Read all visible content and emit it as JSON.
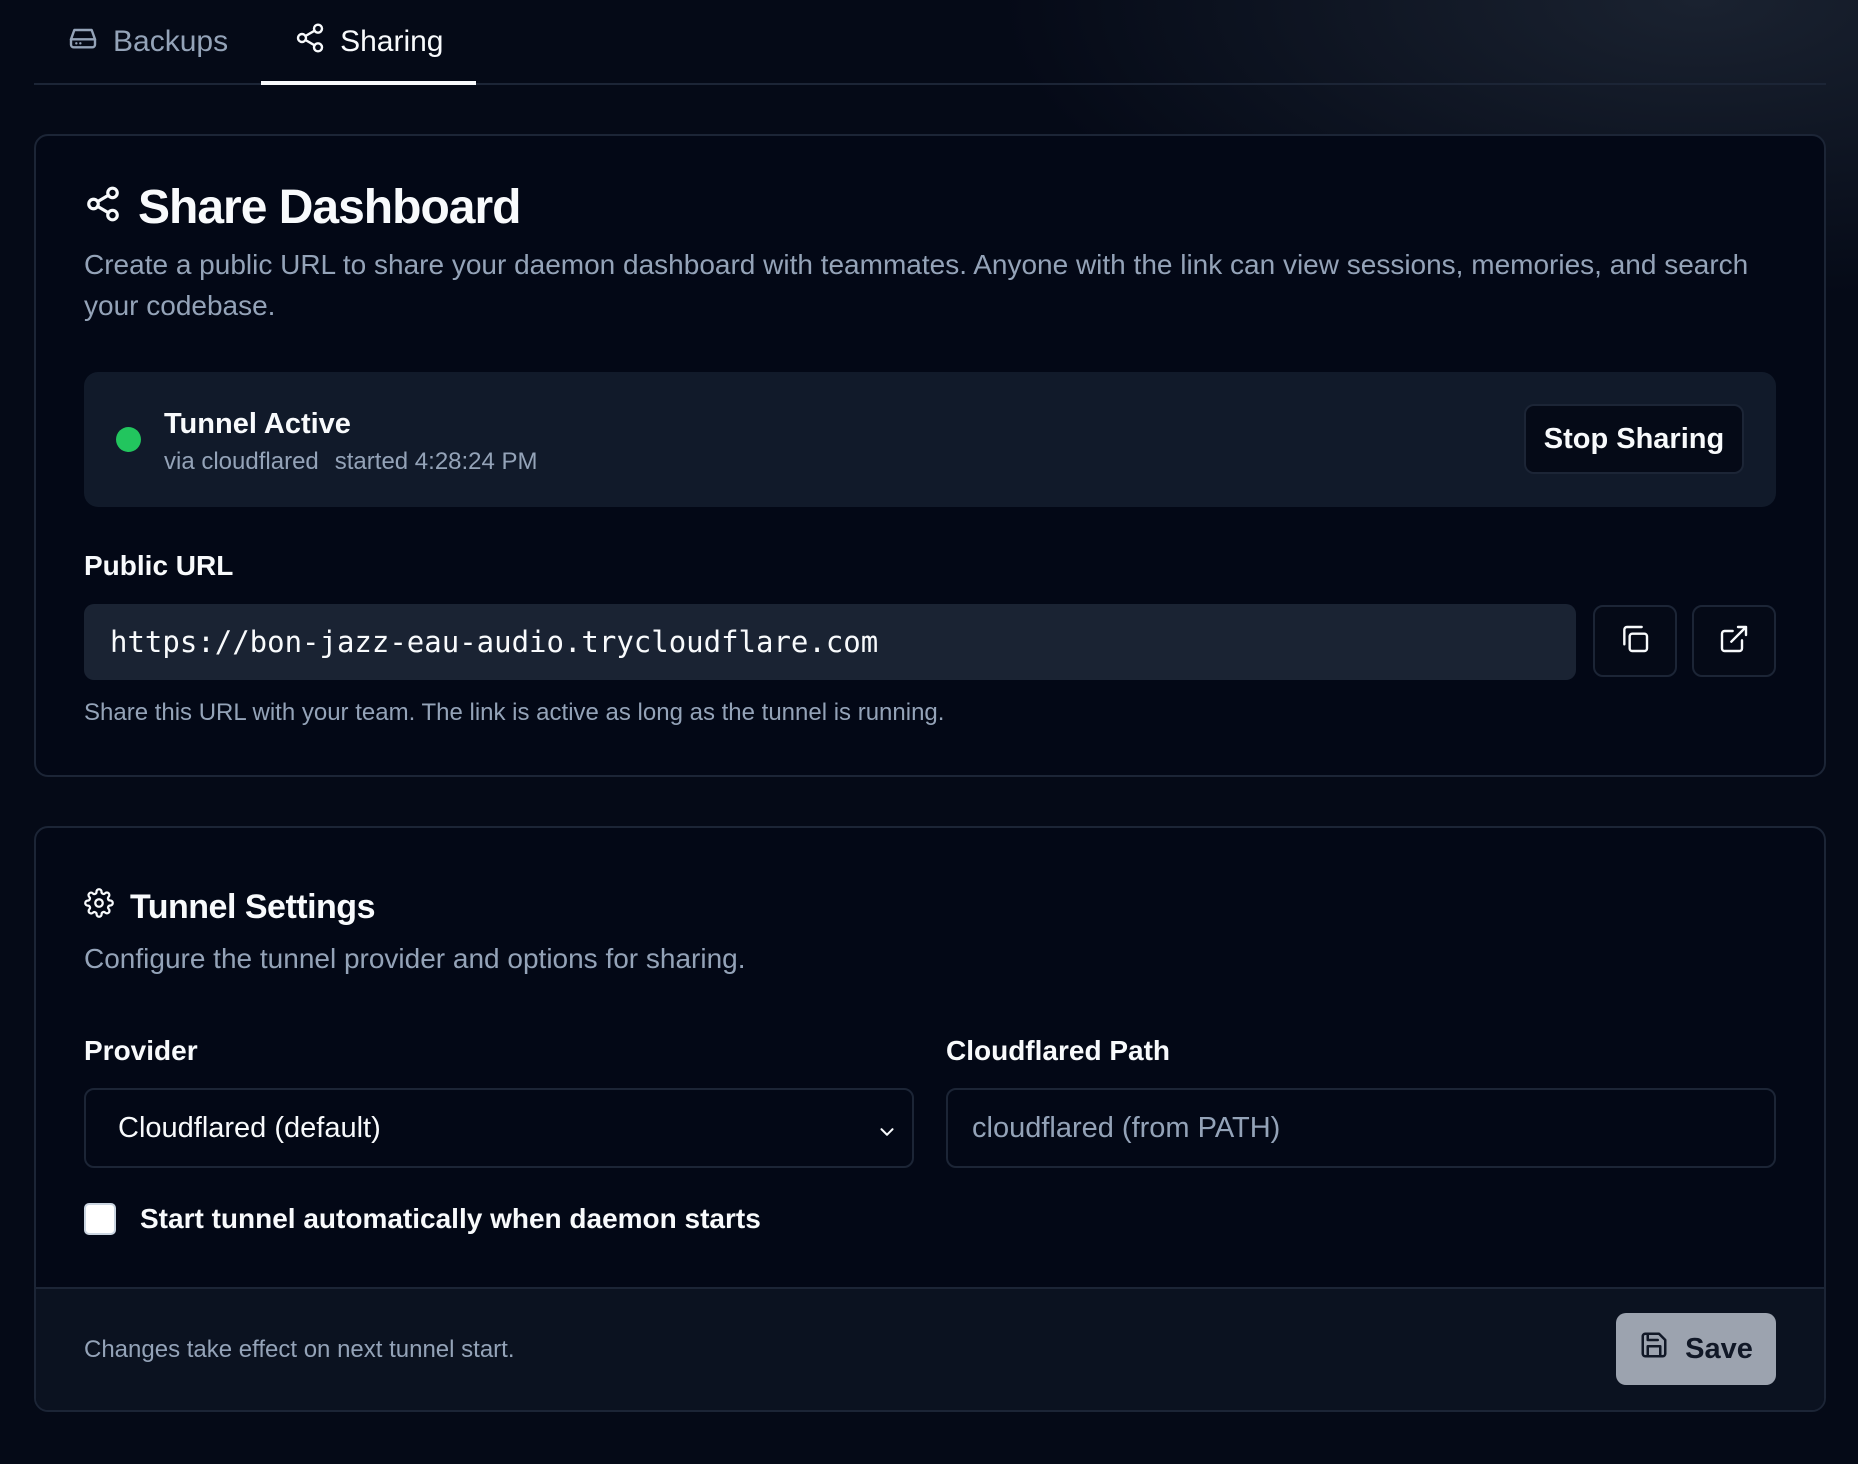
{
  "tabs": [
    {
      "label": "Backups",
      "icon": "hard-drive-icon",
      "active": false
    },
    {
      "label": "Sharing",
      "icon": "share-icon",
      "active": true
    }
  ],
  "share": {
    "title": "Share Dashboard",
    "description": "Create a public URL to share your daemon dashboard with teammates. Anyone with the link can view sessions, memories, and search your codebase.",
    "status": {
      "title": "Tunnel Active",
      "via": "via cloudflared",
      "started": "started 4:28:24 PM",
      "color": "#22c55e"
    },
    "stop_label": "Stop Sharing",
    "url_label": "Public URL",
    "url": "https://bon-jazz-eau-audio.trycloudflare.com",
    "hint": "Share this URL with your team. The link is active as long as the tunnel is running."
  },
  "settings": {
    "title": "Tunnel Settings",
    "description": "Configure the tunnel provider and options for sharing.",
    "provider_label": "Provider",
    "provider_value": "Cloudflared (default)",
    "path_label": "Cloudflared Path",
    "path_placeholder": "cloudflared (from PATH)",
    "autostart_label": "Start tunnel automatically when daemon starts",
    "autostart_checked": false,
    "footer_text": "Changes take effect on next tunnel start.",
    "save_label": "Save"
  }
}
